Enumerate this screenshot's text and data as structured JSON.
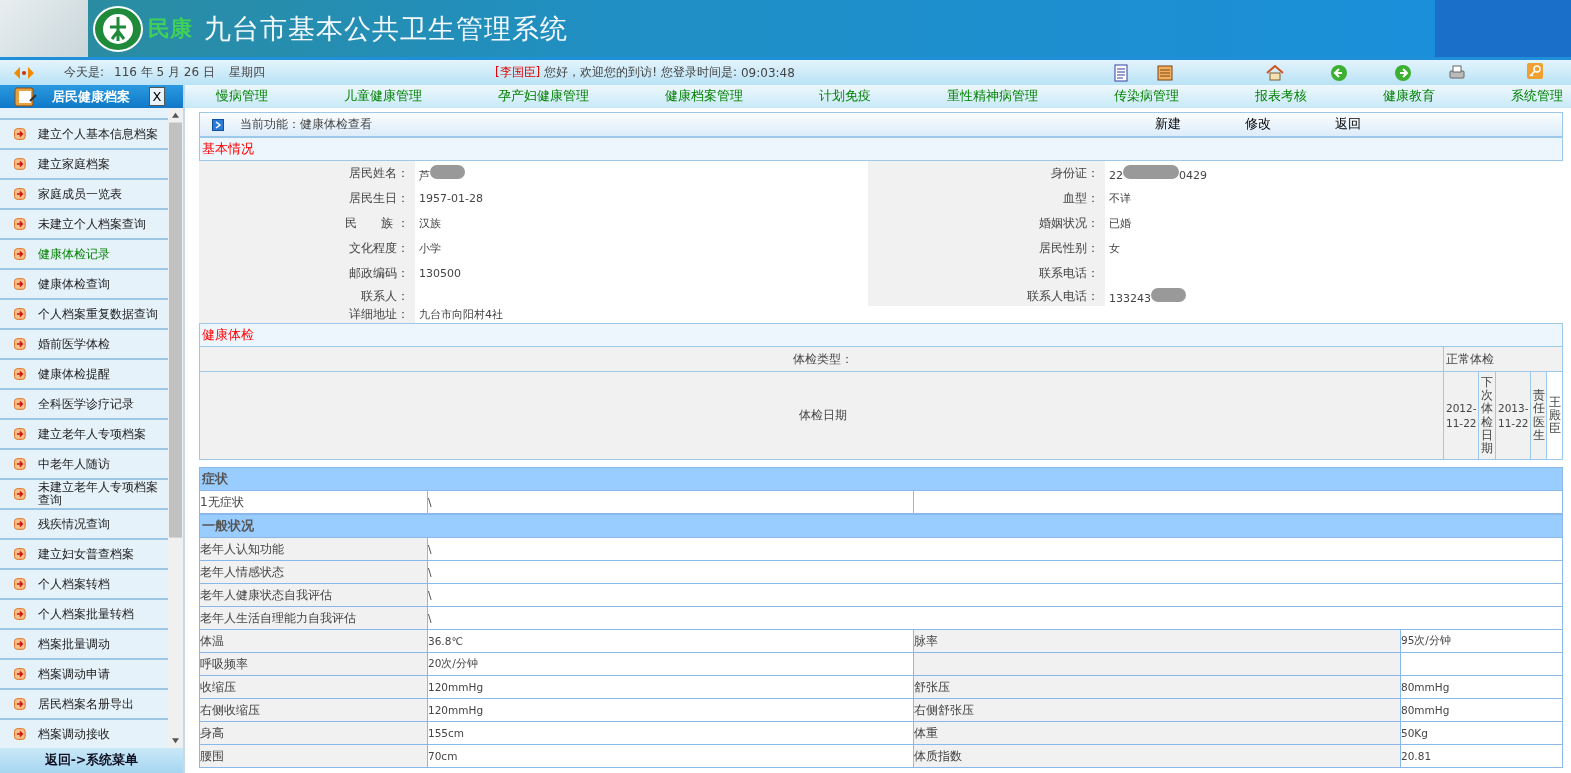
{
  "header": {
    "logo_text": "民康",
    "title": "九台市基本公共卫生管理系统"
  },
  "info_bar": {
    "date_label": "今天是:",
    "date": "116 年 5 月 26 日",
    "weekday": "星期四",
    "user": "[李国臣]",
    "greeting": "您好，欢迎您的到访! 您登录时间是:",
    "login_time": "09:03:48"
  },
  "sidebar": {
    "title": "居民健康档案",
    "close": "X",
    "footer": "返回->系统菜单",
    "items": [
      {
        "label": "建立个人基本信息档案",
        "selected": false
      },
      {
        "label": "建立家庭档案",
        "selected": false
      },
      {
        "label": "家庭成员一览表",
        "selected": false
      },
      {
        "label": "未建立个人档案查询",
        "selected": false
      },
      {
        "label": "健康体检记录",
        "selected": true
      },
      {
        "label": "健康体检查询",
        "selected": false
      },
      {
        "label": "个人档案重复数据查询",
        "selected": false
      },
      {
        "label": "婚前医学体检",
        "selected": false
      },
      {
        "label": "健康体检提醒",
        "selected": false
      },
      {
        "label": "全科医学诊疗记录",
        "selected": false
      },
      {
        "label": "建立老年人专项档案",
        "selected": false
      },
      {
        "label": "中老年人随访",
        "selected": false
      },
      {
        "label": "未建立老年人专项档案查询",
        "selected": false
      },
      {
        "label": "残疾情况查询",
        "selected": false
      },
      {
        "label": "建立妇女普查档案",
        "selected": false
      },
      {
        "label": "个人档案转档",
        "selected": false
      },
      {
        "label": "个人档案批量转档",
        "selected": false
      },
      {
        "label": "档案批量调动",
        "selected": false
      },
      {
        "label": "档案调动申请",
        "selected": false
      },
      {
        "label": "居民档案名册导出",
        "selected": false
      },
      {
        "label": "档案调动接收",
        "selected": false
      }
    ]
  },
  "nav": {
    "items": [
      "慢病管理",
      "儿童健康管理",
      "孕产妇健康管理",
      "健康档案管理",
      "计划免疫",
      "重性精神病管理",
      "传染病管理",
      "报表考核",
      "健康教育",
      "系统管理"
    ]
  },
  "function_bar": {
    "label": "当前功能：健康体检查看",
    "actions": [
      "新建",
      "修改",
      "返回"
    ]
  },
  "basic_info": {
    "title": "基本情况",
    "rows": [
      {
        "left": {
          "label": "居民姓名：",
          "value": "芦",
          "redacted": true
        },
        "right": {
          "label": "身份证：",
          "value": "22",
          "redacted": true,
          "value_after": "0429"
        }
      },
      {
        "left": {
          "label": "居民生日：",
          "value": "1957-01-28"
        },
        "right": {
          "label": "血型：",
          "value": "不详"
        }
      },
      {
        "left": {
          "label": "民　　族 ：",
          "value": "汉族"
        },
        "right": {
          "label": "婚姻状况：",
          "value": "已婚"
        }
      },
      {
        "left": {
          "label": "文化程度：",
          "value": "小学"
        },
        "right": {
          "label": "居民性别：",
          "value": "女"
        }
      },
      {
        "left": {
          "label": "邮政编码：",
          "value": "130500"
        },
        "right": {
          "label": "联系电话："
        }
      },
      {
        "left": {
          "label": "联系人："
        },
        "right": {
          "label": "联系人电话：",
          "value": "133243",
          "redacted": true
        }
      },
      {
        "left": {
          "label": "详细地址：",
          "value": "九台市向阳村4社"
        }
      }
    ]
  },
  "exam": {
    "title": "健康体检",
    "type_label": "体检类型：",
    "type_value": "正常体检",
    "date_label": "体检日期",
    "date": "2012-11-22",
    "next_label": "下次体检日期",
    "next_date": "2013-11-22",
    "doctor_label": "责任医生",
    "doctor": "王殿臣"
  },
  "symptoms": {
    "title": "症状",
    "rows": [
      {
        "label": "1无症状",
        "value": "\\"
      }
    ]
  },
  "general": {
    "title": "一般状况",
    "rows": [
      {
        "kind": "wide",
        "label": "老年人认知功能",
        "value": "\\"
      },
      {
        "kind": "wide",
        "label": "老年人情感状态",
        "value": "\\"
      },
      {
        "kind": "wide",
        "label": "老年人健康状态自我评估",
        "value": "\\"
      },
      {
        "kind": "wide",
        "label": "老年人生活自理能力自我评估",
        "value": "\\"
      },
      {
        "kind": "pair",
        "label": "体温",
        "value": "36.8℃",
        "label_2": "脉率",
        "value_2": "95次/分钟"
      },
      {
        "kind": "pair",
        "label": "呼吸频率",
        "value": "20次/分钟"
      },
      {
        "kind": "pair",
        "label": "收缩压",
        "value": "120mmHg",
        "label_2": "舒张压",
        "value_2": "80mmHg"
      },
      {
        "kind": "pair",
        "label": "右侧收缩压",
        "value": "120mmHg",
        "label_2": "右侧舒张压",
        "value_2": "80mmHg"
      },
      {
        "kind": "pair",
        "label": "身高",
        "value": "155cm",
        "label_2": "体重",
        "value_2": "50Kg"
      },
      {
        "kind": "pair",
        "label": "腰围",
        "value": "70cm",
        "label_2": "体质指数",
        "value_2": "20.81"
      }
    ]
  }
}
